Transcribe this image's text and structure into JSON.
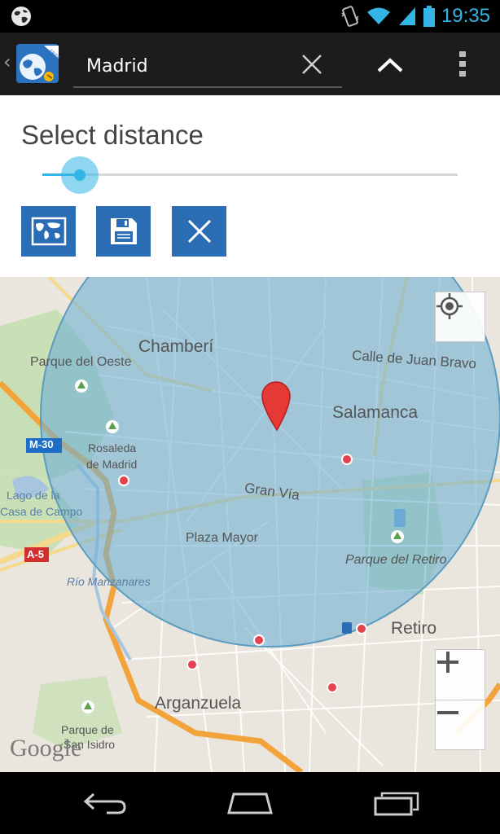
{
  "status_bar": {
    "time": "19:35",
    "icons": [
      "globe-icon",
      "vibrate-icon",
      "wifi-icon",
      "signal-icon",
      "battery-icon"
    ],
    "accent_color": "#33b5e5"
  },
  "action_bar": {
    "search_value": "Madrid",
    "icons": [
      "back-chevron-icon",
      "app-logo-icon",
      "clear-icon",
      "collapse-icon",
      "overflow-menu-icon"
    ],
    "app_logo_badge": "FREE"
  },
  "panel": {
    "title": "Select distance",
    "slider_level": 0.09,
    "buttons": [
      "world-map-icon",
      "save-icon",
      "close-icon"
    ],
    "button_color": "#2a6db5"
  },
  "map": {
    "labels": {
      "chamberi": "Chamberí",
      "parque_oeste": "Parque del Oeste",
      "juan_bravo": "Calle de Juan Bravo",
      "salamanca": "Salamanca",
      "m30": "M-30",
      "rosaleda1": "Rosaleda",
      "rosaleda2": "de Madrid",
      "lago1": "Lago de la",
      "lago2": "Casa de Campo",
      "gran_via": "Gran Vía",
      "plaza_mayor": "Plaza Mayor",
      "a5": "A-5",
      "retiro_park": "Parque del Retiro",
      "rio": "Río Manzanares",
      "retiro": "Retiro",
      "arganzuela": "Arganzuela",
      "san_isidro1": "Parque de",
      "san_isidro2": "San Isidro",
      "google": "Google"
    },
    "controls": [
      "my-location-icon",
      "zoom-in-icon",
      "zoom-out-icon"
    ],
    "radius_color": "#6fb1d3"
  },
  "nav_bar": {
    "buttons": [
      "back-icon",
      "home-icon",
      "recent-apps-icon"
    ]
  }
}
